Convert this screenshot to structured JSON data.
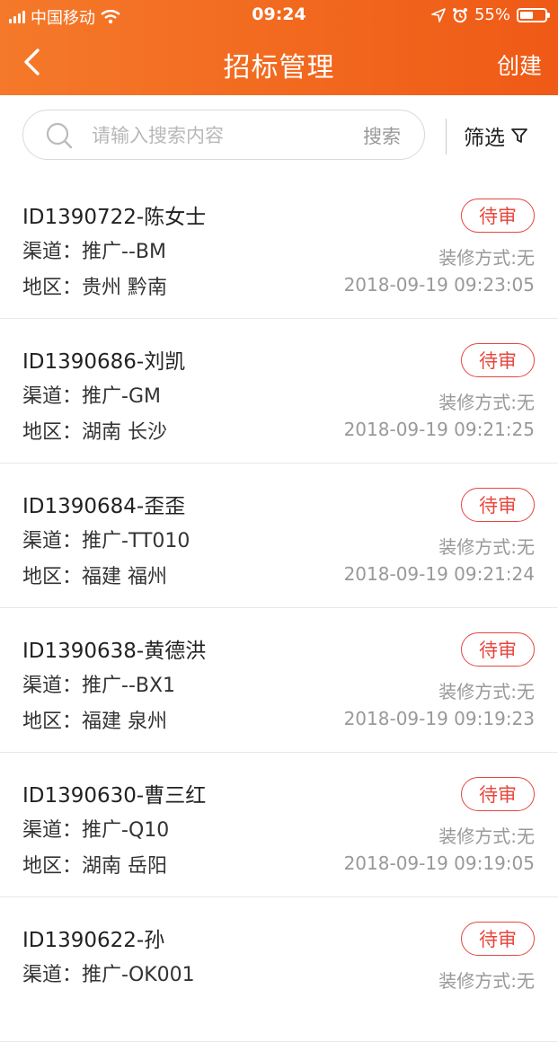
{
  "status_bar": {
    "carrier": "中国移动",
    "time": "09:24",
    "battery": "55%",
    "battery_level": 0.55
  },
  "nav": {
    "title": "招标管理",
    "create_label": "创建"
  },
  "search": {
    "placeholder": "请输入搜索内容",
    "button_label": "搜索",
    "filter_label": "筛选"
  },
  "items": [
    {
      "id": "ID1390722-陈女士",
      "channel": "渠道：推广--BM",
      "region": "地区：贵州 黔南",
      "status": "待审",
      "decoration": "装修方式:无",
      "time": "2018-09-19 09:23:05"
    },
    {
      "id": "ID1390686-刘凯",
      "channel": "渠道：推广-GM",
      "region": "地区：湖南 长沙",
      "status": "待审",
      "decoration": "装修方式:无",
      "time": "2018-09-19 09:21:25"
    },
    {
      "id": "ID1390684-歪歪",
      "channel": "渠道：推广-TT010",
      "region": "地区：福建 福州",
      "status": "待审",
      "decoration": "装修方式:无",
      "time": "2018-09-19 09:21:24"
    },
    {
      "id": "ID1390638-黄德洪",
      "channel": "渠道：推广--BX1",
      "region": "地区：福建 泉州",
      "status": "待审",
      "decoration": "装修方式:无",
      "time": "2018-09-19 09:19:23"
    },
    {
      "id": "ID1390630-曹三红",
      "channel": "渠道：推广-Q10",
      "region": "地区：湖南 岳阳",
      "status": "待审",
      "decoration": "装修方式:无",
      "time": "2018-09-19 09:19:05"
    },
    {
      "id": "ID1390622-孙",
      "channel": "渠道：推广-OK001",
      "region": "",
      "status": "待审",
      "decoration": "装修方式:无",
      "time": ""
    }
  ],
  "colors": {
    "header_start": "#f5792a",
    "header_end": "#ef5a16",
    "status_badge": "#e8463c",
    "secondary_text": "#999999"
  }
}
